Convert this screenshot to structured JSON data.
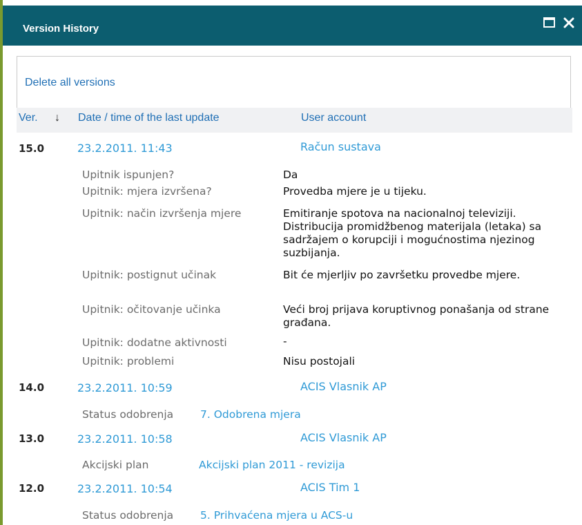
{
  "window": {
    "title": "Version History"
  },
  "toolbar": {
    "delete_all_label": "Delete all versions"
  },
  "table": {
    "headers": {
      "version": "Ver.",
      "sort_arrow": "↓",
      "date": "Date / time of the last update",
      "user": "User account"
    }
  },
  "versions": [
    {
      "version": "15.0",
      "date": "23.2.2011. 11:43",
      "user": "Račun sustava",
      "fields": [
        {
          "label": "Upitnik ispunjen?",
          "value": "Da"
        },
        {
          "label": "Upitnik: mjera izvršena?",
          "value": "Provedba mjere je u tijeku."
        },
        {
          "label": "Upitnik: način izvršenja mjere",
          "value": "Emitiranje spotova na nacionalnoj televiziji. Distribucija promidžbenog materijala (letaka) sa sadržajem o korupciji i mogućnostima njezinog suzbijanja."
        },
        {
          "label": "Upitnik: postignut učinak",
          "value": "Bit će mjerljiv po završetku provedbe mjere."
        },
        {
          "label": "Upitnik: očitovanje učinka",
          "value": "Veći broj prijava koruptivnog ponašanja od strane građana."
        },
        {
          "label": "Upitnik: dodatne aktivnosti",
          "value": "-"
        },
        {
          "label": "Upitnik: problemi",
          "value": "Nisu postojali"
        }
      ]
    },
    {
      "version": "14.0",
      "date": "23.2.2011. 10:59",
      "user": "ACIS Vlasnik AP",
      "fields": [
        {
          "label": "Status odobrenja",
          "value": "7. Odobrena mjera"
        }
      ]
    },
    {
      "version": "13.0",
      "date": "23.2.2011. 10:58",
      "user": "ACIS Vlasnik AP",
      "fields": [
        {
          "label": "Akcijski plan",
          "value": "Akcijski plan 2011 - revizija"
        }
      ]
    },
    {
      "version": "12.0",
      "date": "23.2.2011. 10:54",
      "user": "ACIS Tim 1",
      "fields": [
        {
          "label": "Status odobrenja",
          "value": "5. Prihvaćena mjera u ACS-u"
        }
      ]
    }
  ]
}
